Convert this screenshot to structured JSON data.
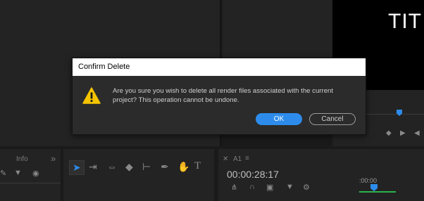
{
  "dialog": {
    "title": "Confirm Delete",
    "message_line1": "Are you sure you wish to delete all render files associated with the current",
    "message_line2": "project? This operation cannot be undone.",
    "ok_label": "OK",
    "cancel_label": "Cancel",
    "icon": "warning-icon"
  },
  "program_monitor": {
    "title_text": "TIT"
  },
  "panels": {
    "info_tab": "Info",
    "overflow": "»",
    "timeline_name": "A1"
  },
  "timeline": {
    "timecode": "00:00:28:17",
    "ruler_time": ":00:00"
  },
  "colors": {
    "accent": "#2d8ceb",
    "warning": "#f5c400",
    "in_out_bar": "#2bb24c"
  }
}
